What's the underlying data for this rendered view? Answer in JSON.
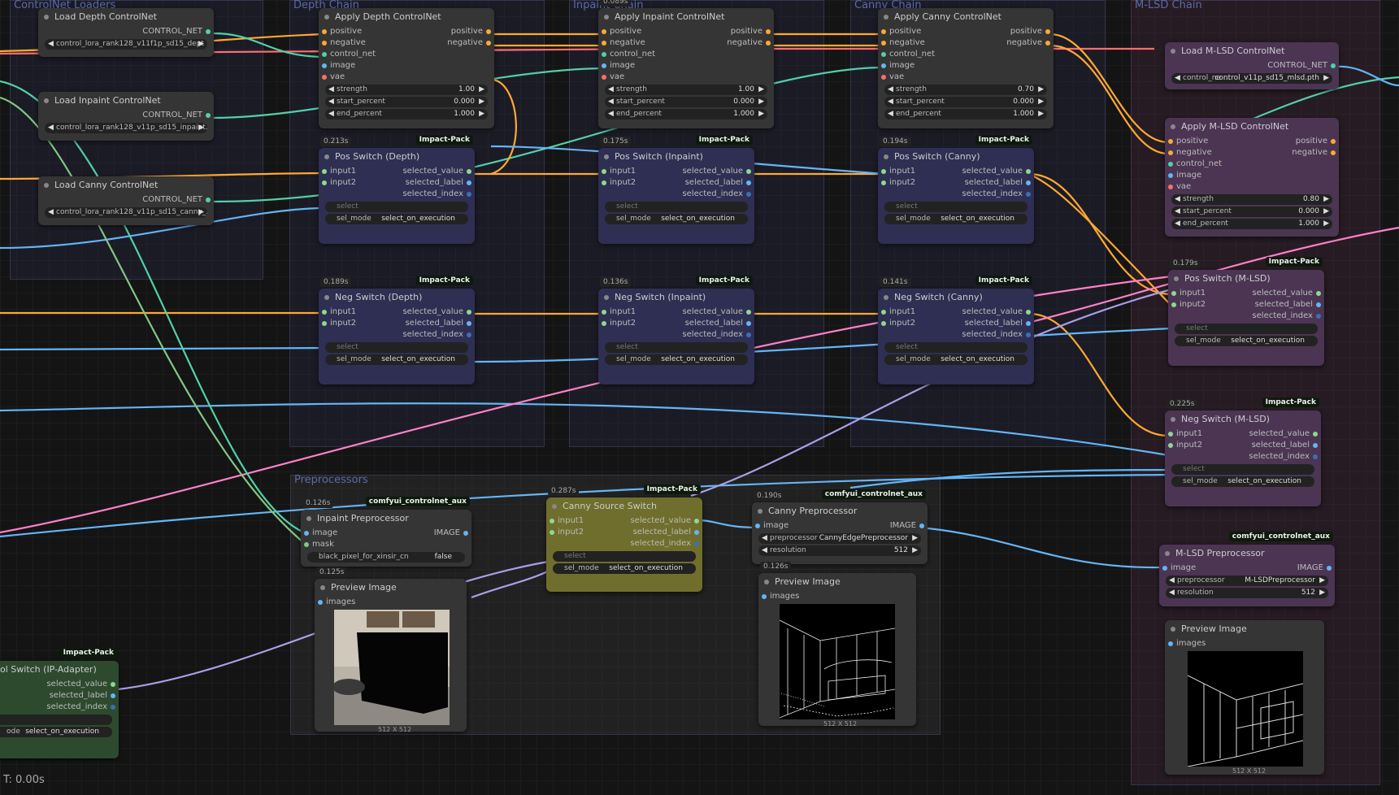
{
  "groups": {
    "loaders": "ControlNet Loaders",
    "depth": "Depth Chain",
    "inpaint": "Inpaint Chain",
    "canny": "Canny Chain",
    "mlsd": "M-LSD Chain",
    "pre": "Preprocessors"
  },
  "colors": {
    "accent": "#e8a23a",
    "conditioning": "#ffa931",
    "control": "#52d0a7",
    "image": "#64b5f6",
    "vae": "#ff6e6e",
    "link_pink": "#ff80c8",
    "link_violet": "#a89fe8",
    "mask_green": "#81c784"
  },
  "badges": {
    "impact": "Impact-Pack",
    "aux": "comfyui_controlnet_aux"
  },
  "widgets_common": {
    "select": "select",
    "sel_mode": "sel_mode",
    "sel_value": "select_on_execution"
  },
  "sockets": {
    "positive": "positive",
    "negative": "negative",
    "control_net": "control_net",
    "image": "image",
    "vae": "vae",
    "input1": "input1",
    "input2": "input2",
    "selected_value": "selected_value",
    "selected_label": "selected_label",
    "selected_index": "selected_index",
    "CONTROL_NET": "CONTROL_NET",
    "IMAGE": "IMAGE",
    "images": "images",
    "mask": "mask"
  },
  "params": {
    "strength": "strength",
    "start_percent": "start_percent",
    "end_percent": "end_percent"
  },
  "loaders": [
    {
      "title": "Load Depth ControlNet",
      "file": "control_lora_rank128_v11f1p_sd15_dept ..."
    },
    {
      "title": "Load Inpaint ControlNet",
      "file": "control_lora_rank128_v11p_sd15_inpaint..."
    },
    {
      "title": "Load Canny ControlNet",
      "file": "control_lora_rank128_v11p_sd15_canny_..."
    }
  ],
  "apply": {
    "depth": {
      "title": "Apply Depth ControlNet",
      "strength": "1.00",
      "start": "0.000",
      "end": "1.000"
    },
    "inpaint": {
      "title": "Apply Inpaint ControlNet",
      "timing": "0.089s",
      "strength": "1.00",
      "start": "0.000",
      "end": "1.000"
    },
    "canny": {
      "title": "Apply Canny ControlNet",
      "strength": "0.70",
      "start": "0.000",
      "end": "1.000"
    },
    "mlsd": {
      "title": "Apply M-LSD ControlNet",
      "strength": "0.80",
      "start": "0.000",
      "end": "1.000"
    }
  },
  "switches": {
    "pos_depth": {
      "title": "Pos Switch (Depth)",
      "timing": "0.213s"
    },
    "pos_inpaint": {
      "title": "Pos Switch (Inpaint)",
      "timing": "0.175s"
    },
    "pos_canny": {
      "title": "Pos Switch (Canny)",
      "timing": "0.194s"
    },
    "neg_depth": {
      "title": "Neg Switch (Depth)",
      "timing": "0.189s"
    },
    "neg_inpaint": {
      "title": "Neg Switch (Inpaint)",
      "timing": "0.136s"
    },
    "neg_canny": {
      "title": "Neg Switch (Canny)",
      "timing": "0.141s"
    },
    "pos_mlsd": {
      "title": "Pos Switch (M-LSD)",
      "timing": "0.179s"
    },
    "neg_mlsd": {
      "title": "Neg Switch (M-LSD)",
      "timing": "0.225s"
    },
    "canny_src": {
      "title": "Canny Source Switch",
      "timing": "0.287s"
    },
    "ipadapter": {
      "title": "ol Switch (IP-Adapter)"
    }
  },
  "mlsd_loader": {
    "title": "Load M-LSD ControlNet",
    "file_label": "control_ne ...",
    "file": "control_v11p_sd15_mlsd.pth"
  },
  "preprocessors": {
    "inpaint": {
      "title": "Inpaint Preprocessor",
      "timing": "0.126s",
      "param": "black_pixel_for_xinsir_cn",
      "value": "false"
    },
    "canny": {
      "title": "Canny Preprocessor",
      "timing": "0.190s",
      "pre_label": "preprocessor",
      "pre_value": "CannyEdgePreprocessor",
      "res_label": "resolution",
      "res_value": "512"
    },
    "mlsd": {
      "title": "M-LSD Preprocessor",
      "pre_label": "preprocessor",
      "pre_value": "M-LSDPreprocessor",
      "res_label": "resolution",
      "res_value": "512"
    }
  },
  "previews": {
    "inpaint": {
      "title": "Preview Image",
      "timing": "0.125s",
      "size": "512 X 512"
    },
    "canny": {
      "title": "Preview Image",
      "timing": "0.126s",
      "size": "512 X 512"
    },
    "mlsd": {
      "title": "Preview Image",
      "size": "512 X 512"
    }
  },
  "ipadapter": {
    "sel_mode_partial": "ode",
    "sel_value": "select_on_execution"
  },
  "status": "T: 0.00s"
}
